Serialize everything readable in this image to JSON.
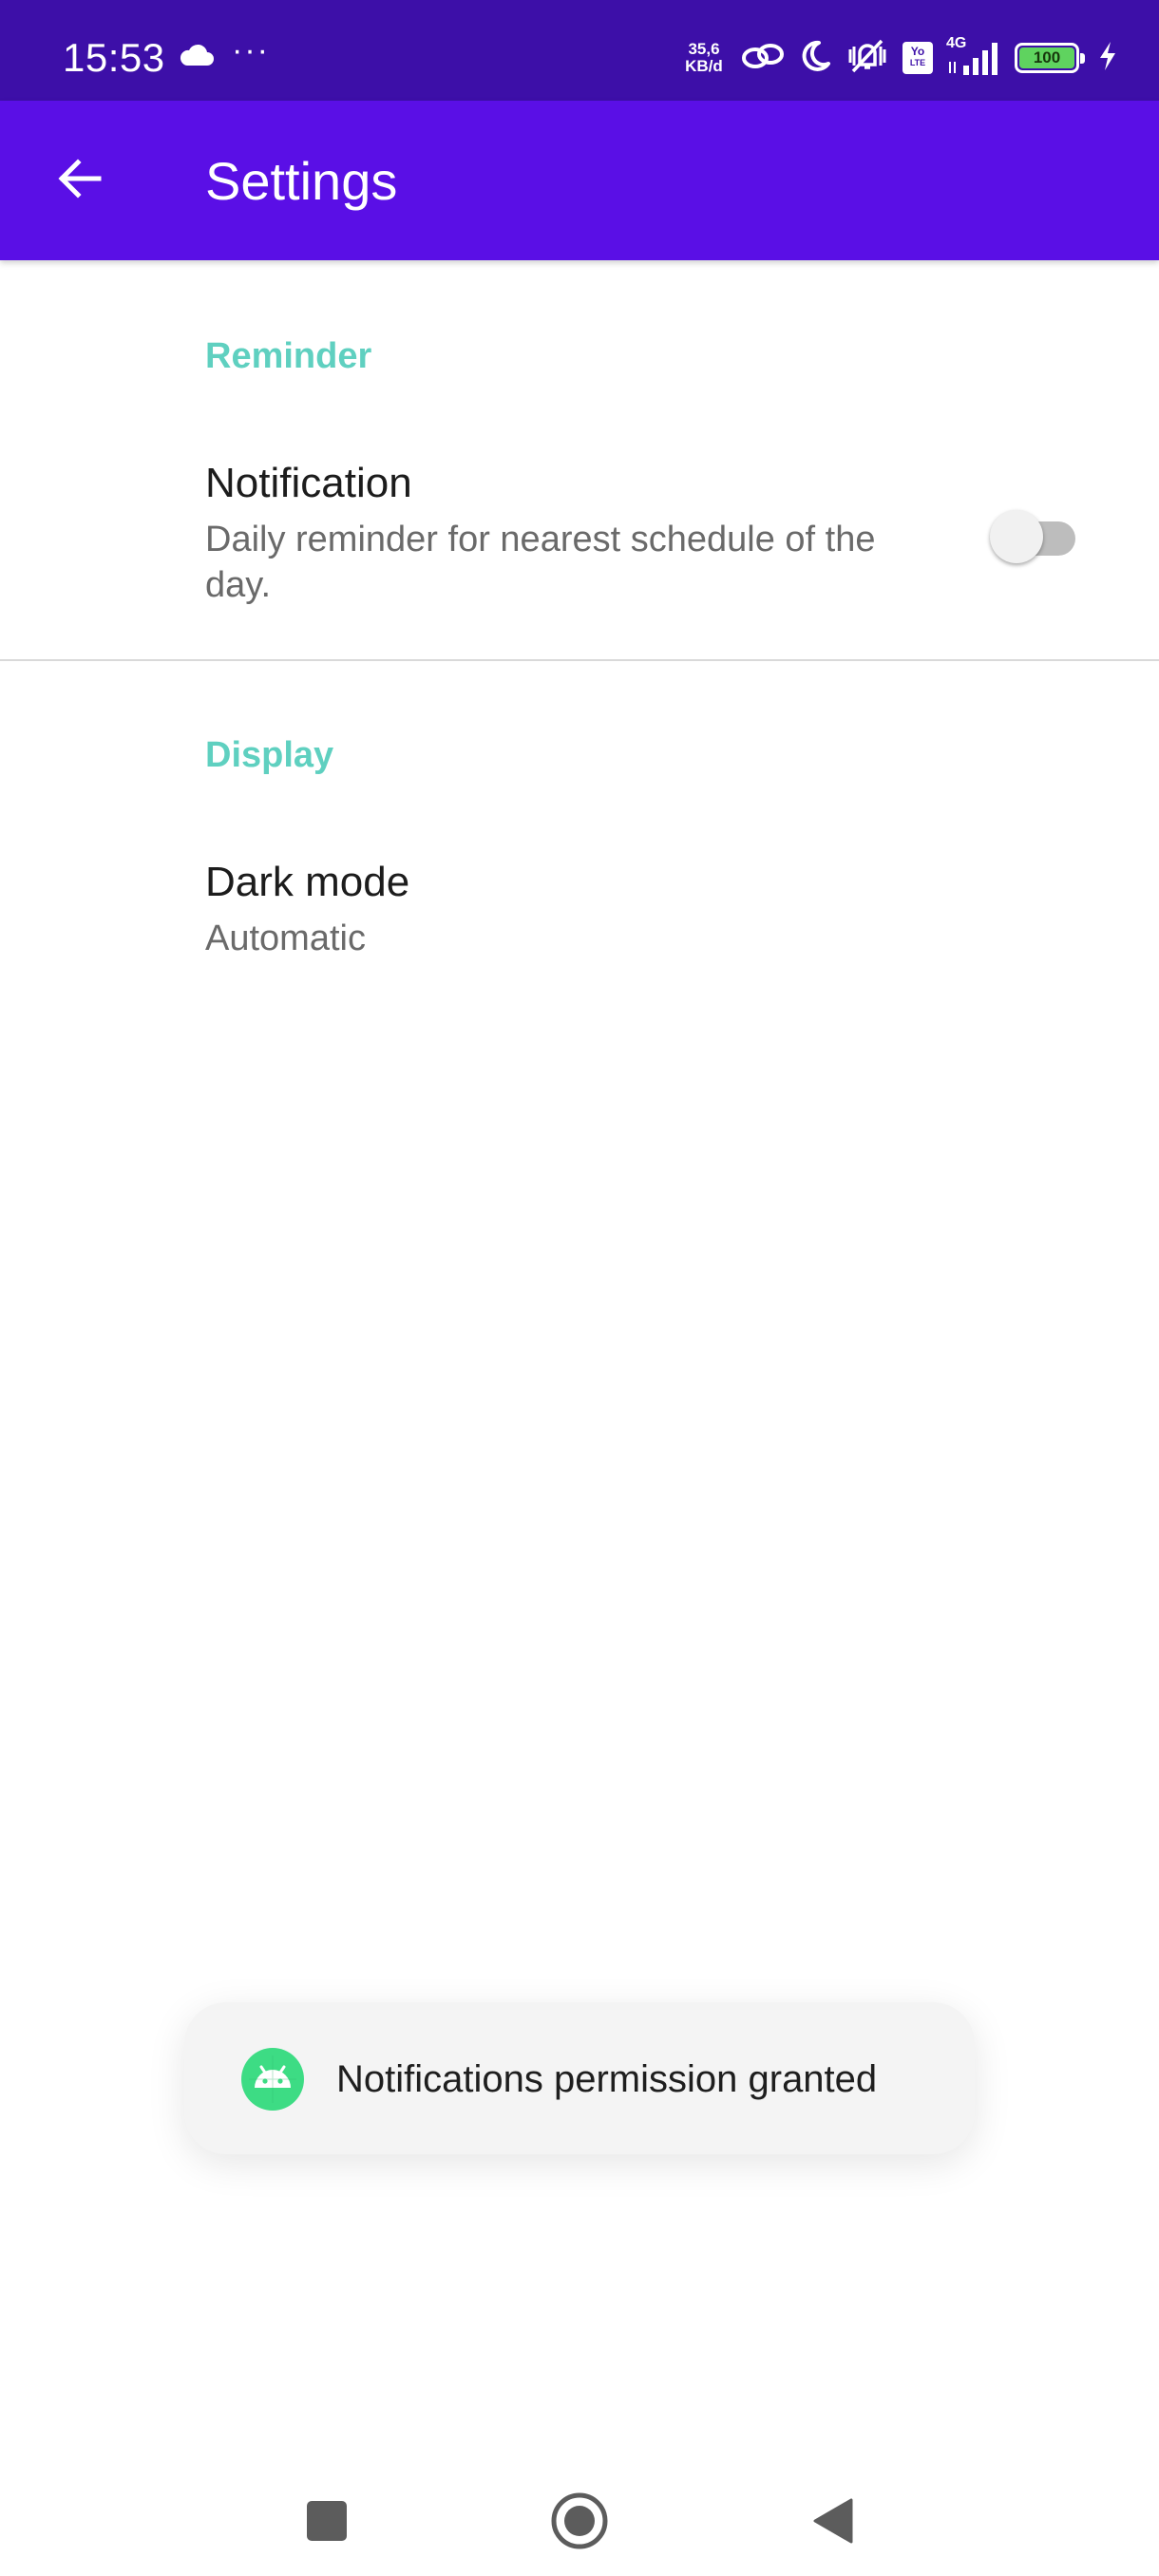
{
  "status_bar": {
    "time": "15:53",
    "dots": "···",
    "net_speed_value": "35,6",
    "net_speed_unit": "KB/d",
    "volte_top": "Yo",
    "volte_bottom": "LTE",
    "network_type": "4G",
    "battery_level": "100",
    "icons": [
      "cloud-icon",
      "link-icon",
      "moon-icon",
      "mute-vibrate-icon",
      "volte-icon",
      "signal-icon",
      "battery-icon",
      "charging-icon"
    ]
  },
  "app_bar": {
    "title": "Settings",
    "back_icon": "arrow-back-icon",
    "background": "#5a0fe6"
  },
  "sections": {
    "reminder": {
      "header": "Reminder",
      "notification": {
        "title": "Notification",
        "summary": "Daily reminder for nearest schedule of the day.",
        "enabled": false
      }
    },
    "display": {
      "header": "Display",
      "dark_mode": {
        "title": "Dark mode",
        "summary": "Automatic"
      }
    }
  },
  "toast": {
    "message": "Notifications permission granted",
    "icon": "android-icon"
  },
  "nav_bar": {
    "buttons": [
      "recents-button",
      "home-button",
      "back-button"
    ]
  },
  "colors": {
    "status_bar": "#3d0fa8",
    "accent": "#5fd0c0",
    "app_bar": "#5a0fe6"
  }
}
